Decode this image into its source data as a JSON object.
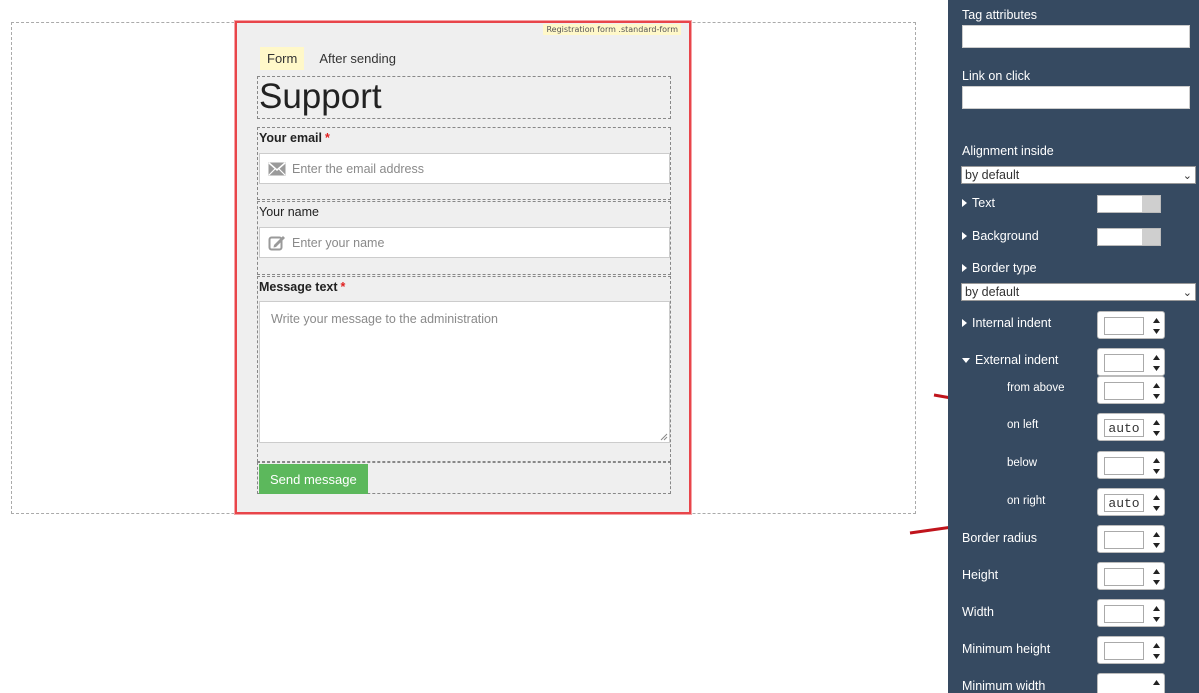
{
  "canvas": {
    "block_tag": "Registration form .standard-form",
    "tabs": [
      {
        "label": "Form",
        "active": true
      },
      {
        "label": "After sending",
        "active": false
      }
    ],
    "heading": "Support",
    "fields": {
      "email": {
        "label": "Your email",
        "required": "*",
        "placeholder": "Enter the email address",
        "icon": "envelope-icon"
      },
      "name": {
        "label": "Your name",
        "placeholder": "Enter your name",
        "icon": "edit-icon"
      },
      "message": {
        "label": "Message text",
        "required": "*",
        "placeholder": "Write your message to the administration"
      }
    },
    "send_button": "Send message",
    "colors": {
      "selection_border": "#e8454a",
      "button": "#5cb85c",
      "tag_bg": "#fff8c9"
    }
  },
  "panel": {
    "tag_attributes": "Tag attributes",
    "link_on_click": "Link on click",
    "alignment_inside": {
      "label": "Alignment inside",
      "value": "by default"
    },
    "text": "Text",
    "background": "Background",
    "border_type": {
      "label": "Border type",
      "value": "by default"
    },
    "internal_indent": "Internal indent",
    "external_indent": "External indent",
    "from_above": "from above",
    "on_left": {
      "label": "on left",
      "value": "auto"
    },
    "below": "below",
    "on_right": {
      "label": "on right",
      "value": "auto"
    },
    "border_radius": "Border radius",
    "height": "Height",
    "width": "Width",
    "min_height": "Minimum height",
    "min_width": "Minimum width",
    "colors": {
      "background": "#364a61",
      "arrow": "#c0141c"
    }
  }
}
